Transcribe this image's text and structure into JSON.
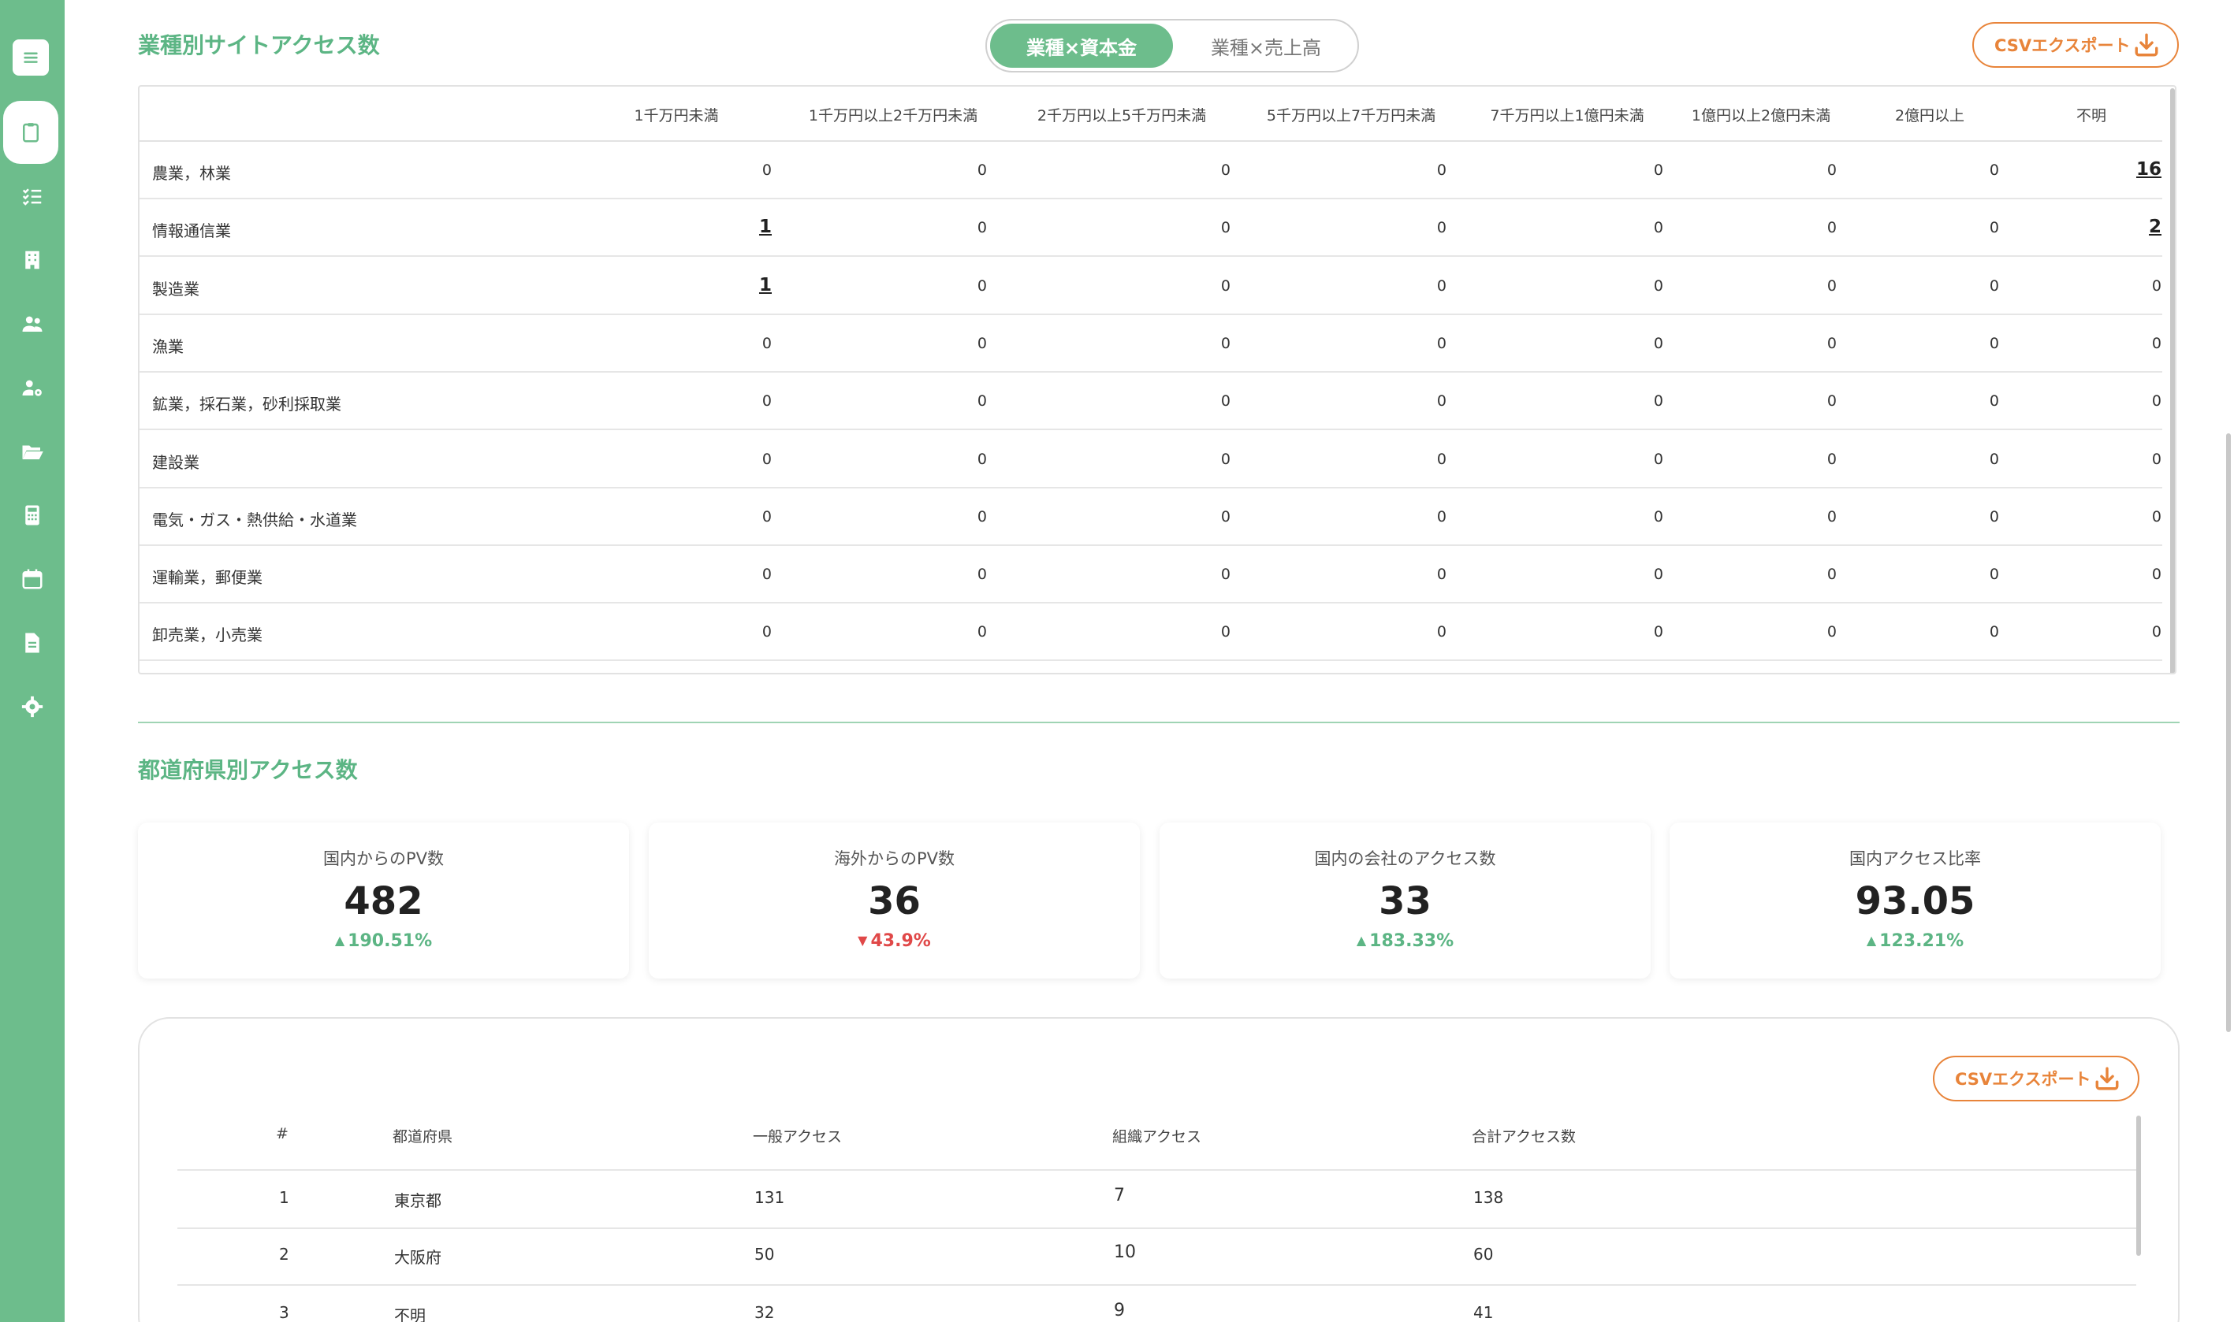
{
  "colors": {
    "accent": "#6dbd8c",
    "title": "#5cb584",
    "export": "#e8843a",
    "up": "#5cb584",
    "down": "#e04848"
  },
  "sidebar": {
    "icons": [
      "menu-icon",
      "clipboard-icon",
      "checklist-icon",
      "building-icon",
      "users-icon",
      "user-gear-icon",
      "folder-open-icon",
      "calculator-icon",
      "calendar-icon",
      "document-icon",
      "gear-icon"
    ]
  },
  "industry": {
    "title": "業種別サイトアクセス数",
    "toggle": {
      "active": "業種×資本金",
      "inactive": "業種×売上高"
    },
    "export_label": "CSVエクスポート",
    "columns": [
      "1千万円未満",
      "1千万円以上2千万円未満",
      "2千万円以上5千万円未満",
      "5千万円以上7千万円未満",
      "7千万円以上1億円未満",
      "1億円以上2億円未満",
      "2億円以上",
      "不明"
    ],
    "rows": [
      {
        "label": "農業，林業",
        "values": [
          "0",
          "0",
          "0",
          "0",
          "0",
          "0",
          "0",
          "16"
        ],
        "links": [
          false,
          false,
          false,
          false,
          false,
          false,
          false,
          true
        ]
      },
      {
        "label": "情報通信業",
        "values": [
          "1",
          "0",
          "0",
          "0",
          "0",
          "0",
          "0",
          "2"
        ],
        "links": [
          true,
          false,
          false,
          false,
          false,
          false,
          false,
          true
        ]
      },
      {
        "label": "製造業",
        "values": [
          "1",
          "0",
          "0",
          "0",
          "0",
          "0",
          "0",
          "0"
        ],
        "links": [
          true,
          false,
          false,
          false,
          false,
          false,
          false,
          false
        ]
      },
      {
        "label": "漁業",
        "values": [
          "0",
          "0",
          "0",
          "0",
          "0",
          "0",
          "0",
          "0"
        ],
        "links": [
          false,
          false,
          false,
          false,
          false,
          false,
          false,
          false
        ]
      },
      {
        "label": "鉱業，採石業，砂利採取業",
        "values": [
          "0",
          "0",
          "0",
          "0",
          "0",
          "0",
          "0",
          "0"
        ],
        "links": [
          false,
          false,
          false,
          false,
          false,
          false,
          false,
          false
        ]
      },
      {
        "label": "建設業",
        "values": [
          "0",
          "0",
          "0",
          "0",
          "0",
          "0",
          "0",
          "0"
        ],
        "links": [
          false,
          false,
          false,
          false,
          false,
          false,
          false,
          false
        ]
      },
      {
        "label": "電気・ガス・熱供給・水道業",
        "values": [
          "0",
          "0",
          "0",
          "0",
          "0",
          "0",
          "0",
          "0"
        ],
        "links": [
          false,
          false,
          false,
          false,
          false,
          false,
          false,
          false
        ]
      },
      {
        "label": "運輸業，郵便業",
        "values": [
          "0",
          "0",
          "0",
          "0",
          "0",
          "0",
          "0",
          "0"
        ],
        "links": [
          false,
          false,
          false,
          false,
          false,
          false,
          false,
          false
        ]
      },
      {
        "label": "卸売業，小売業",
        "values": [
          "0",
          "0",
          "0",
          "0",
          "0",
          "0",
          "0",
          "0"
        ],
        "links": [
          false,
          false,
          false,
          false,
          false,
          false,
          false,
          false
        ]
      }
    ]
  },
  "prefecture": {
    "title": "都道府県別アクセス数",
    "cards": [
      {
        "label": "国内からのPV数",
        "value": "482",
        "change": "190.51%",
        "direction": "up"
      },
      {
        "label": "海外からのPV数",
        "value": "36",
        "change": "43.9%",
        "direction": "down"
      },
      {
        "label": "国内の会社のアクセス数",
        "value": "33",
        "change": "183.33%",
        "direction": "up"
      },
      {
        "label": "国内アクセス比率",
        "value": "93.05",
        "change": "123.21%",
        "direction": "up"
      }
    ],
    "export_label": "CSVエクスポート",
    "columns": [
      "#",
      "都道府県",
      "一般アクセス",
      "組織アクセス",
      "合計アクセス数"
    ],
    "rows": [
      [
        "1",
        "東京都",
        "131",
        "7",
        "138"
      ],
      [
        "2",
        "大阪府",
        "50",
        "10",
        "60"
      ],
      [
        "3",
        "不明",
        "32",
        "9",
        "41"
      ]
    ]
  }
}
